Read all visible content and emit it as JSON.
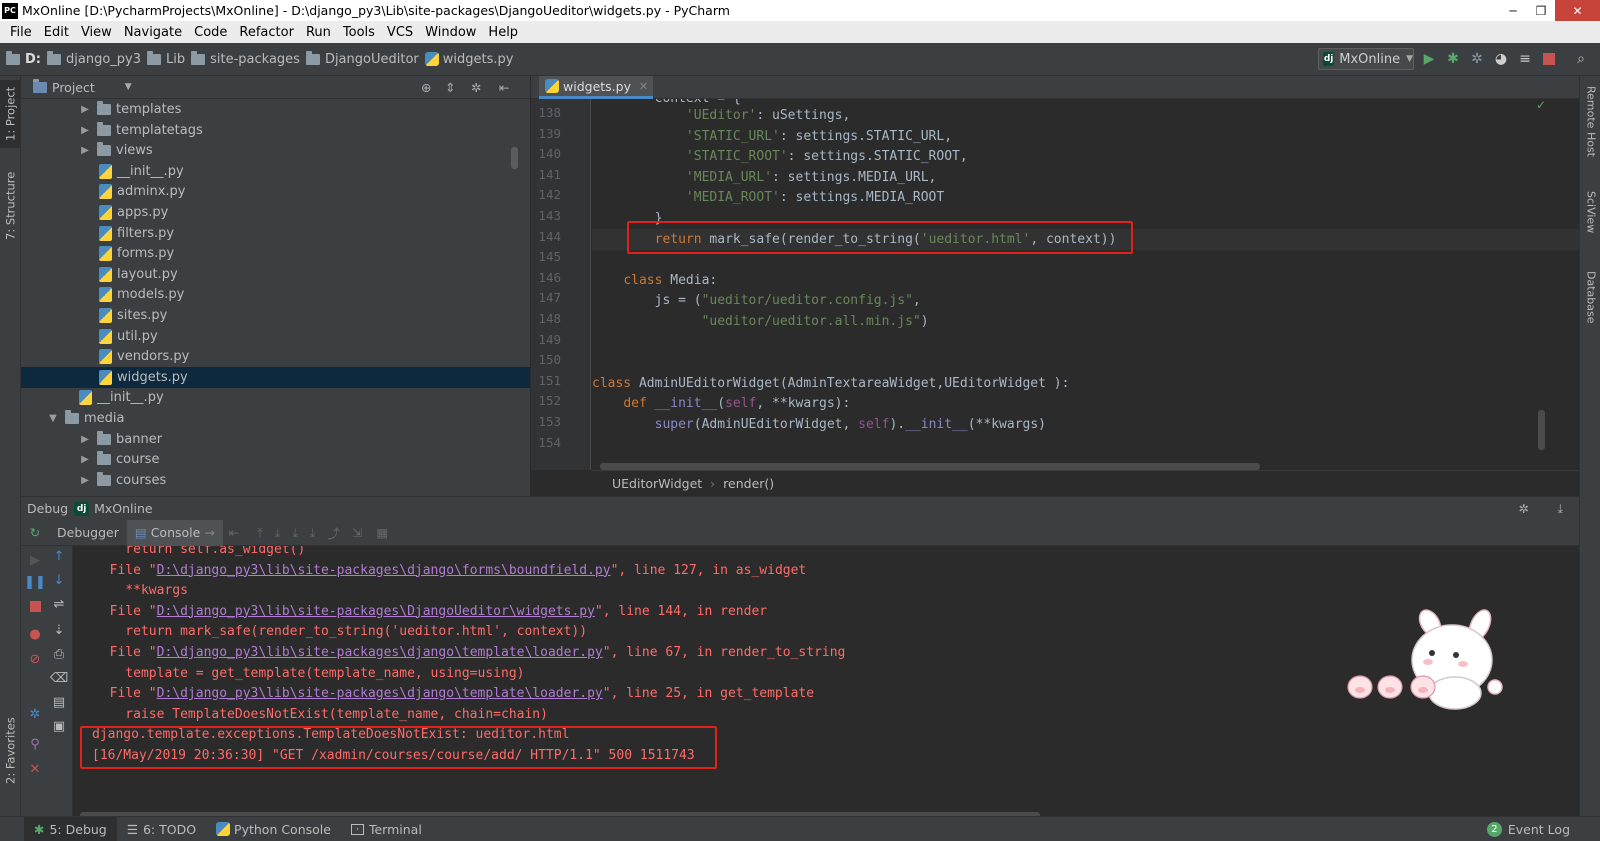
{
  "window": {
    "title": "MxOnline [D:\\PycharmProjects\\MxOnline] - D:\\django_py3\\Lib\\site-packages\\DjangoUeditor\\widgets.py - PyCharm",
    "logo": "PC"
  },
  "menu": [
    "File",
    "Edit",
    "View",
    "Navigate",
    "Code",
    "Refactor",
    "Run",
    "Tools",
    "VCS",
    "Window",
    "Help"
  ],
  "breadcrumbs": [
    "D:",
    "django_py3",
    "Lib",
    "site-packages",
    "DjangoUeditor",
    "widgets.py"
  ],
  "run_config": {
    "label": "MxOnline",
    "badge": "dj"
  },
  "left_stripe": [
    "1: Project",
    "7: Structure",
    "2: Favorites"
  ],
  "right_stripe": [
    "Remote Host",
    "SciView",
    "Database"
  ],
  "project": {
    "header": "Project",
    "tree": [
      {
        "label": "templates",
        "kind": "folder",
        "expandable": true,
        "depth": 2
      },
      {
        "label": "templatetags",
        "kind": "folder",
        "expandable": true,
        "depth": 2
      },
      {
        "label": "views",
        "kind": "folder",
        "expandable": true,
        "depth": 2
      },
      {
        "label": "__init__.py",
        "kind": "file",
        "depth": 3
      },
      {
        "label": "adminx.py",
        "kind": "file",
        "depth": 3
      },
      {
        "label": "apps.py",
        "kind": "file",
        "depth": 3
      },
      {
        "label": "filters.py",
        "kind": "file",
        "depth": 3
      },
      {
        "label": "forms.py",
        "kind": "file",
        "depth": 3
      },
      {
        "label": "layout.py",
        "kind": "file",
        "depth": 3
      },
      {
        "label": "models.py",
        "kind": "file",
        "depth": 3
      },
      {
        "label": "sites.py",
        "kind": "file",
        "depth": 3
      },
      {
        "label": "util.py",
        "kind": "file",
        "depth": 3
      },
      {
        "label": "vendors.py",
        "kind": "file",
        "depth": 3
      },
      {
        "label": "widgets.py",
        "kind": "file",
        "depth": 3,
        "selected": true
      },
      {
        "label": "__init__.py",
        "kind": "file",
        "depth": 2
      },
      {
        "label": "media",
        "kind": "folder",
        "expanded": true,
        "depth": 1
      },
      {
        "label": "banner",
        "kind": "folder",
        "expandable": true,
        "depth": 2
      },
      {
        "label": "course",
        "kind": "folder",
        "expandable": true,
        "depth": 2
      },
      {
        "label": "courses",
        "kind": "folder",
        "expandable": true,
        "depth": 2
      }
    ]
  },
  "editor": {
    "tab": "widgets.py",
    "line_numbers": [
      "138",
      "139",
      "140",
      "141",
      "142",
      "143",
      "144",
      "145",
      "146",
      "147",
      "148",
      "149",
      "150",
      "151",
      "152",
      "153",
      "154"
    ],
    "breadcrumb": [
      "UEditorWidget",
      "render()"
    ]
  },
  "debug": {
    "title": "Debug",
    "config": "MxOnline",
    "tabs": [
      "Debugger",
      "Console"
    ],
    "trace": [
      {
        "pre": "    return self.as_widget()",
        "link": "",
        "post": ""
      },
      {
        "pre": "  File \"",
        "link": "D:\\django_py3\\lib\\site-packages\\django\\forms\\boundfield.py",
        "post": "\", line 127, in as_widget"
      },
      {
        "pre": "    **kwargs",
        "link": "",
        "post": ""
      },
      {
        "pre": "  File \"",
        "link": "D:\\django_py3\\lib\\site-packages\\DjangoUeditor\\widgets.py",
        "post": "\", line 144, in render"
      },
      {
        "pre": "    return mark_safe(render_to_string('ueditor.html', context))",
        "link": "",
        "post": ""
      },
      {
        "pre": "  File \"",
        "link": "D:\\django_py3\\lib\\site-packages\\django\\template\\loader.py",
        "post": "\", line 67, in render_to_string"
      },
      {
        "pre": "    template = get_template(template_name, using=using)",
        "link": "",
        "post": ""
      },
      {
        "pre": "  File \"",
        "link": "D:\\django_py3\\lib\\site-packages\\django\\template\\loader.py",
        "post": "\", line 25, in get_template"
      },
      {
        "pre": "    raise TemplateDoesNotExist(template_name, chain=chain)",
        "link": "",
        "post": ""
      },
      {
        "pre": "django.template.exceptions.TemplateDoesNotExist: ueditor.html",
        "link": "",
        "post": ""
      },
      {
        "pre": "[16/May/2019 20:36:30] \"GET /xadmin/courses/course/add/ HTTP/1.1\" 500 1511743",
        "link": "",
        "post": ""
      }
    ]
  },
  "bottom_tabs": [
    "5: Debug",
    "6: TODO",
    "Python Console",
    "Terminal"
  ],
  "event_log": {
    "label": "Event Log",
    "count": "2"
  },
  "colors": {
    "highlight_box": "#e0221b",
    "error_text": "#ff6b68",
    "link_text": "#b07cd1",
    "selection": "#0d293e"
  }
}
